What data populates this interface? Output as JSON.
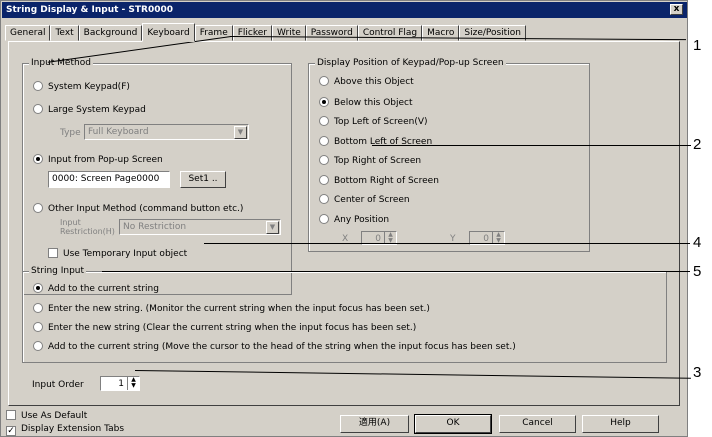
{
  "window": {
    "title": "String Display & Input - STR0000",
    "close": "x"
  },
  "tabs": [
    "General",
    "Text",
    "Background",
    "Keyboard",
    "Frame",
    "Flicker",
    "Write",
    "Password",
    "Control Flag",
    "Macro",
    "Size/Position"
  ],
  "active_tab": "Keyboard",
  "input_method": {
    "title": "Input Method",
    "system_keypad": "System Keypad(F)",
    "large_keypad": "Large System Keypad",
    "type_label": "Type",
    "type_value": "Full Keyboard",
    "popup": "Input from Pop-up Screen",
    "popup_value": "0000: Screen Page0000",
    "set_button": "Set1 ..",
    "other": "Other Input Method (command button etc.)",
    "restriction_label_1": "Input",
    "restriction_label_2": "Restriction(H)",
    "restriction_value": "No Restriction",
    "temp_input": "Use Temporary Input object"
  },
  "display_position": {
    "title": "Display Position of Keypad/Pop-up Screen",
    "options": [
      "Above this Object",
      "Below this Object",
      "Top Left of Screen(V)",
      "Bottom Left of Screen",
      "Top Right of Screen",
      "Bottom Right of Screen",
      "Center of Screen",
      "Any Position"
    ],
    "selected_index": 1,
    "x_label": "X",
    "x_value": "0",
    "y_label": "Y",
    "y_value": "0"
  },
  "string_input": {
    "title": "String Input",
    "options": [
      "Add to the current string",
      "Enter the new string. (Monitor the current string when the input focus has been set.)",
      "Enter the new string (Clear the current string when the input focus has been set.)",
      "Add to the current string (Move the cursor to the head of the string when the input focus has been set.)"
    ],
    "selected_index": 0
  },
  "input_order": {
    "label": "Input Order",
    "value": "1"
  },
  "footer": {
    "use_as_default": "Use As Default",
    "display_ext_tabs": "Display Extension Tabs",
    "apply": "適用(A)",
    "ok": "OK",
    "cancel": "Cancel",
    "help": "Help"
  },
  "callouts": [
    "1",
    "2",
    "3",
    "4",
    "5"
  ]
}
